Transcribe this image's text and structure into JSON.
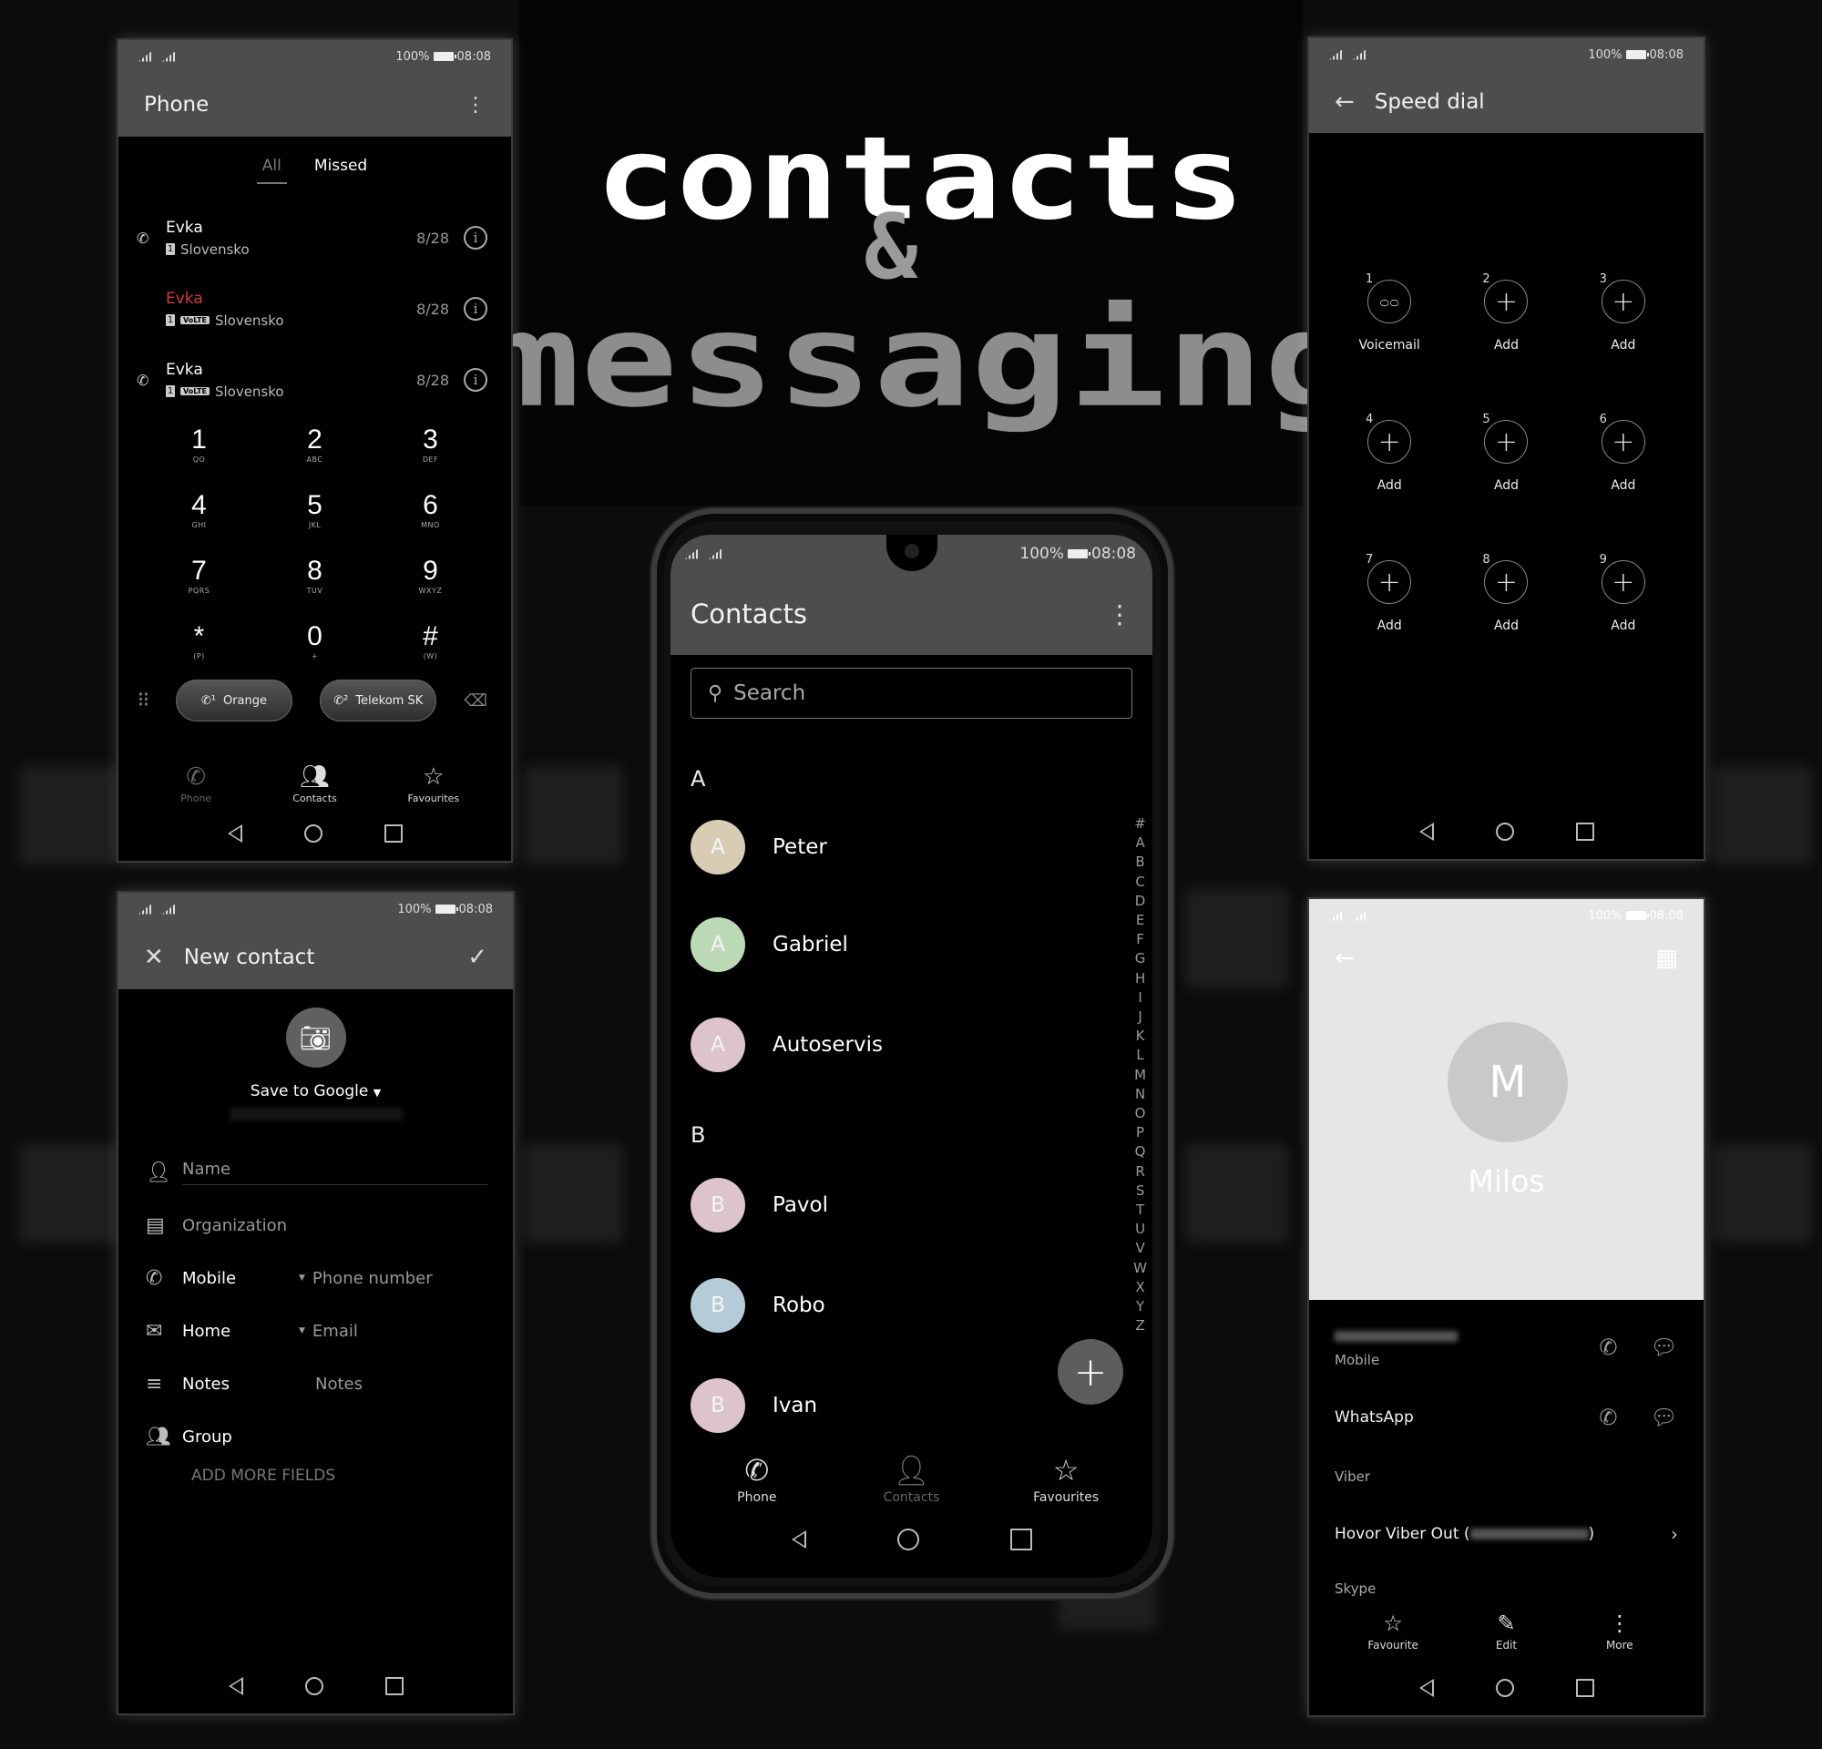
{
  "banner": {
    "line1": "contacts",
    "line2": "&",
    "line3": "messaging"
  },
  "status": {
    "battery": "100%",
    "time": "08:08"
  },
  "phone_screen": {
    "title": "Phone",
    "tabs": [
      {
        "label": "All",
        "active": true
      },
      {
        "label": "Missed",
        "active": false
      }
    ],
    "calls": [
      {
        "name": "Evka",
        "type": "outgoing",
        "sim": "1",
        "volte": false,
        "location": "Slovensko",
        "date": "8/28"
      },
      {
        "name": "Evka",
        "type": "missed",
        "sim": "1",
        "volte": true,
        "location": "Slovensko",
        "date": "8/28"
      },
      {
        "name": "Evka",
        "type": "outgoing",
        "sim": "1",
        "volte": true,
        "location": "Slovensko",
        "date": "8/28"
      }
    ],
    "volte_label": "VoLTE",
    "keys": [
      {
        "digit": "1",
        "letters": "QO"
      },
      {
        "digit": "2",
        "letters": "ABC"
      },
      {
        "digit": "3",
        "letters": "DEF"
      },
      {
        "digit": "4",
        "letters": "GHI"
      },
      {
        "digit": "5",
        "letters": "JKL"
      },
      {
        "digit": "6",
        "letters": "MNO"
      },
      {
        "digit": "7",
        "letters": "PQRS"
      },
      {
        "digit": "8",
        "letters": "TUV"
      },
      {
        "digit": "9",
        "letters": "WXYZ"
      },
      {
        "digit": "*",
        "letters": "(P)"
      },
      {
        "digit": "0",
        "letters": "+"
      },
      {
        "digit": "#",
        "letters": "(W)"
      }
    ],
    "call_buttons": [
      {
        "label": "Orange",
        "sim": "1"
      },
      {
        "label": "Telekom SK",
        "sim": "2"
      }
    ],
    "bottom_tabs": [
      {
        "label": "Phone",
        "active": true
      },
      {
        "label": "Contacts",
        "active": false
      },
      {
        "label": "Favourites",
        "active": false
      }
    ]
  },
  "contacts_screen": {
    "title": "Contacts",
    "search_placeholder": "Search",
    "sections": [
      {
        "letter": "A",
        "contacts": [
          {
            "initial": "A",
            "name": "Peter",
            "color": "#d8ccb4"
          },
          {
            "initial": "A",
            "name": "Gabriel",
            "color": "#bcd9b6"
          },
          {
            "initial": "A",
            "name": "Autoservis",
            "color": "#dcc3cc"
          }
        ]
      },
      {
        "letter": "B",
        "contacts": [
          {
            "initial": "B",
            "name": "Pavol",
            "color": "#dcc3cc"
          },
          {
            "initial": "B",
            "name": "Robo",
            "color": "#b5cbd8"
          },
          {
            "initial": "B",
            "name": "Ivan",
            "color": "#dcc3cc"
          }
        ]
      }
    ],
    "index": [
      "#",
      "A",
      "B",
      "C",
      "D",
      "E",
      "F",
      "G",
      "H",
      "I",
      "J",
      "K",
      "L",
      "M",
      "N",
      "O",
      "P",
      "Q",
      "R",
      "S",
      "T",
      "U",
      "V",
      "W",
      "X",
      "Y",
      "Z"
    ],
    "bottom_tabs": [
      {
        "label": "Phone"
      },
      {
        "label": "Contacts"
      },
      {
        "label": "Favourites"
      }
    ]
  },
  "speed_dial_screen": {
    "title": "Speed dial",
    "slots": [
      {
        "num": "1",
        "label": "Voicemail",
        "icon": "voicemail"
      },
      {
        "num": "2",
        "label": "Add",
        "icon": "plus"
      },
      {
        "num": "3",
        "label": "Add",
        "icon": "plus"
      },
      {
        "num": "4",
        "label": "Add",
        "icon": "plus"
      },
      {
        "num": "5",
        "label": "Add",
        "icon": "plus"
      },
      {
        "num": "6",
        "label": "Add",
        "icon": "plus"
      },
      {
        "num": "7",
        "label": "Add",
        "icon": "plus"
      },
      {
        "num": "8",
        "label": "Add",
        "icon": "plus"
      },
      {
        "num": "9",
        "label": "Add",
        "icon": "plus"
      }
    ]
  },
  "new_contact_screen": {
    "title": "New contact",
    "save_to": "Save to Google",
    "fields": {
      "name_placeholder": "Name",
      "organization_placeholder": "Organization",
      "mobile_label": "Mobile",
      "phone_placeholder": "Phone number",
      "home_label": "Home",
      "email_placeholder": "Email",
      "notes_label": "Notes",
      "notes_placeholder": "Notes",
      "group_label": "Group"
    },
    "add_more": "ADD MORE FIELDS"
  },
  "contact_detail_screen": {
    "initial": "M",
    "name": "Milos",
    "mobile_label": "Mobile",
    "whatsapp": "WhatsApp",
    "viber_label": "Viber",
    "viber_out": "Hovor Viber Out (",
    "viber_out_end": ")",
    "skype_label": "Skype",
    "actions": [
      {
        "label": "Favourite"
      },
      {
        "label": "Edit"
      },
      {
        "label": "More"
      }
    ]
  }
}
